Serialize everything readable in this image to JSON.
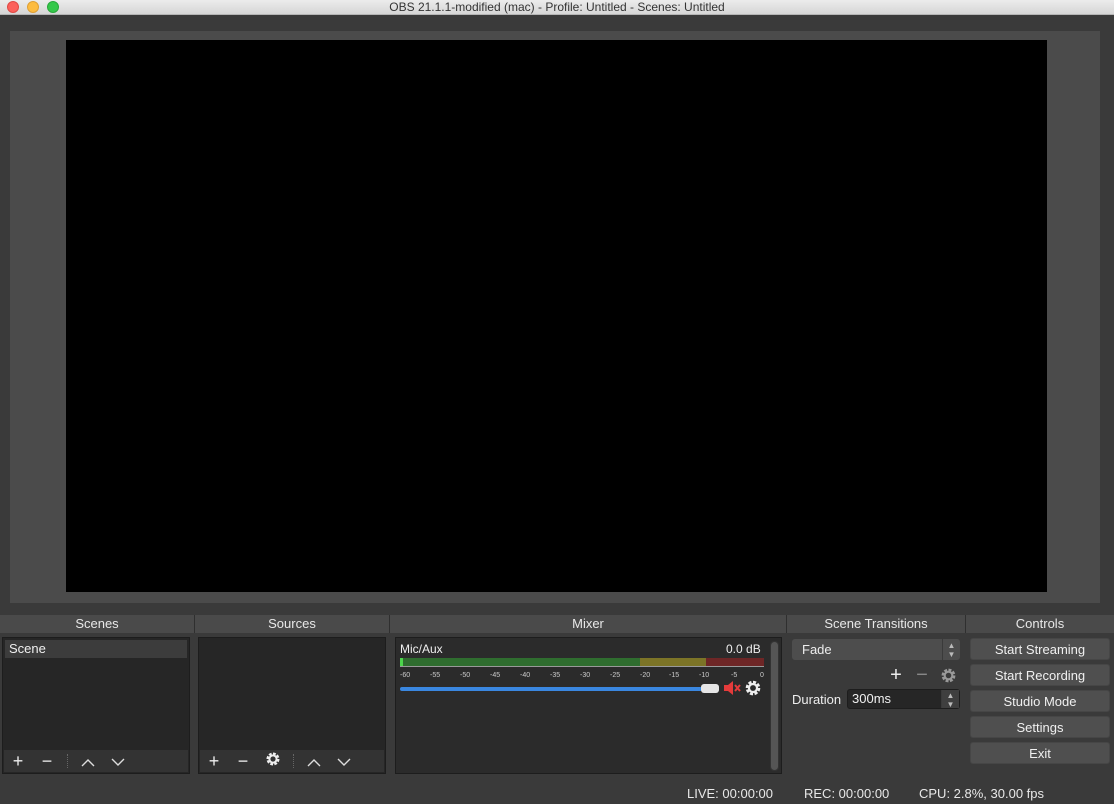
{
  "window": {
    "title": "OBS 21.1.1-modified (mac) - Profile: Untitled - Scenes: Untitled"
  },
  "docks": {
    "scenes": "Scenes",
    "sources": "Sources",
    "mixer": "Mixer",
    "transitions": "Scene Transitions",
    "controls": "Controls"
  },
  "scenes": {
    "items": [
      "Scene"
    ]
  },
  "mixer": {
    "channel": "Mic/Aux",
    "level": "0.0 dB",
    "ticks": [
      "-60",
      "-55",
      "-50",
      "-45",
      "-40",
      "-35",
      "-30",
      "-25",
      "-20",
      "-15",
      "-10",
      "-5",
      "0"
    ],
    "muted": true,
    "colors": {
      "fader": "#3a87e0",
      "mute": "#e53b3b",
      "green": "#2f6d2f",
      "yellow": "#7c7427",
      "red": "#6e2626"
    }
  },
  "transitions": {
    "selected": "Fade",
    "duration_label": "Duration",
    "duration": "300ms"
  },
  "controls": [
    "Start Streaming",
    "Start Recording",
    "Studio Mode",
    "Settings",
    "Exit"
  ],
  "status": {
    "live": "LIVE: 00:00:00",
    "rec": "REC: 00:00:00",
    "cpu": "CPU: 2.8%, 30.00 fps"
  }
}
